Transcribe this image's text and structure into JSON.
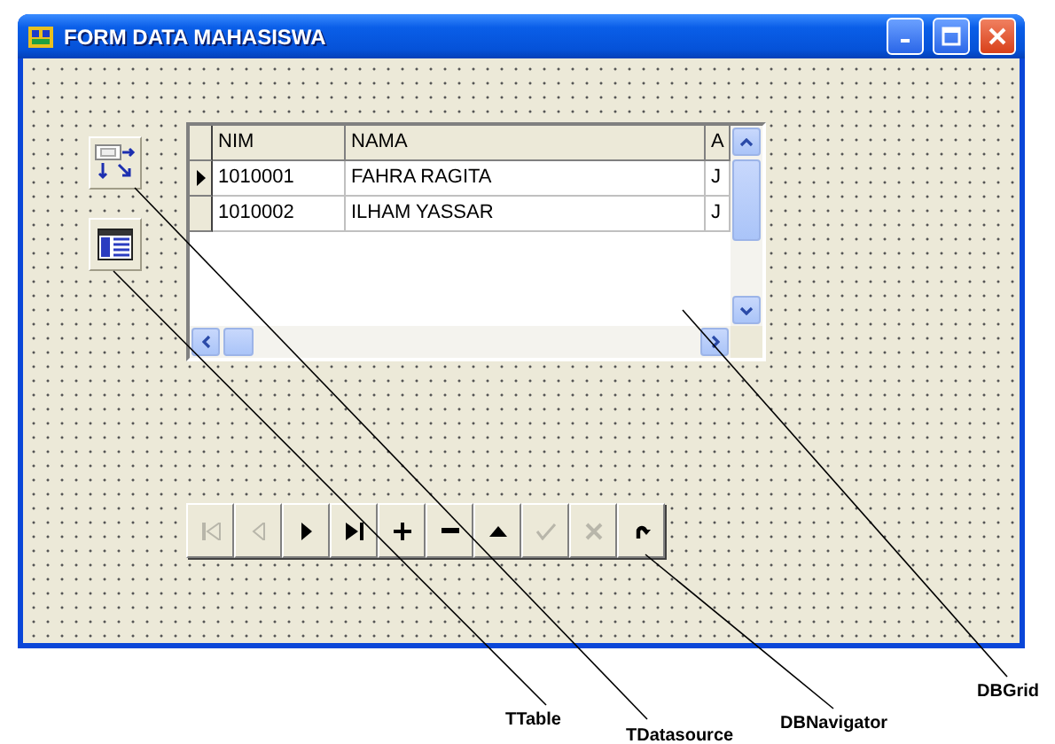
{
  "window": {
    "title": "FORM DATA MAHASISWA",
    "buttons": [
      {
        "kind": "minimize"
      },
      {
        "kind": "maximize"
      },
      {
        "kind": "close"
      }
    ]
  },
  "components": [
    {
      "kind": "datasource"
    },
    {
      "kind": "table"
    }
  ],
  "grid": {
    "columns": [
      "NIM",
      "NAMA",
      "A"
    ],
    "rows": [
      {
        "selected": true,
        "cells": [
          "1010001",
          "FAHRA RAGITA",
          "J"
        ]
      },
      {
        "selected": false,
        "cells": [
          "1010002",
          "ILHAM YASSAR",
          "J"
        ]
      }
    ]
  },
  "navigator": {
    "buttons": [
      {
        "kind": "first",
        "disabled": true
      },
      {
        "kind": "prior",
        "disabled": true
      },
      {
        "kind": "next",
        "disabled": false
      },
      {
        "kind": "last",
        "disabled": false
      },
      {
        "kind": "insert",
        "disabled": false
      },
      {
        "kind": "delete",
        "disabled": false
      },
      {
        "kind": "edit",
        "disabled": false
      },
      {
        "kind": "post",
        "disabled": true
      },
      {
        "kind": "cancel",
        "disabled": true
      },
      {
        "kind": "refresh",
        "disabled": false
      }
    ]
  },
  "annotations": [
    {
      "label": "TTable"
    },
    {
      "label": "TDatasource"
    },
    {
      "label": "DBNavigator"
    },
    {
      "label": "DBGrid"
    }
  ]
}
